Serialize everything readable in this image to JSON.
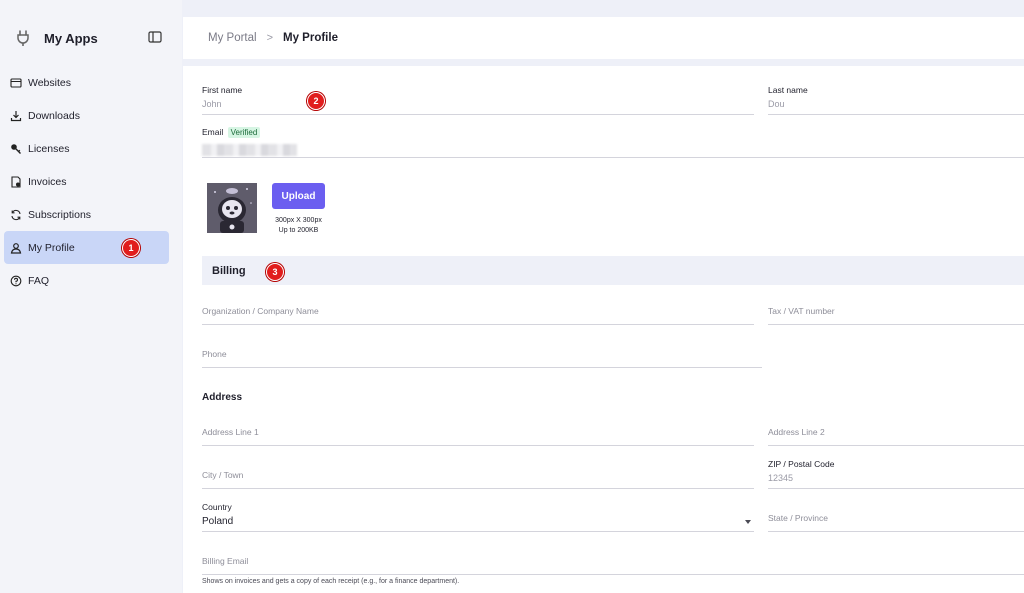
{
  "app": {
    "title": "My Apps",
    "logo_icon": "plug-icon",
    "collapse_icon": "sidebar-toggle-icon"
  },
  "sidebar": {
    "items": [
      {
        "label": "Websites",
        "icon": "browser-window-icon"
      },
      {
        "label": "Downloads",
        "icon": "download-icon"
      },
      {
        "label": "Licenses",
        "icon": "key-icon"
      },
      {
        "label": "Invoices",
        "icon": "invoice-icon"
      },
      {
        "label": "Subscriptions",
        "icon": "refresh-icon"
      },
      {
        "label": "My Profile",
        "icon": "user-icon",
        "active": true
      },
      {
        "label": "FAQ",
        "icon": "help-icon"
      }
    ]
  },
  "breadcrumb": {
    "parent": "My Portal",
    "separator": ">",
    "current": "My Profile"
  },
  "profile": {
    "first_name_label": "First name",
    "first_name_value": "John",
    "last_name_label": "Last name",
    "last_name_value": "Dou",
    "email_label": "Email",
    "email_badge": "Verified",
    "upload_label": "Upload",
    "upload_hint_line1": "300px X 300px",
    "upload_hint_line2": "Up to 200KB"
  },
  "billing": {
    "title": "Billing",
    "company_placeholder": "Organization / Company Name",
    "vat_placeholder": "Tax / VAT number",
    "phone_placeholder": "Phone"
  },
  "address": {
    "title": "Address",
    "line1_placeholder": "Address Line 1",
    "line2_placeholder": "Address Line 2",
    "city_placeholder": "City / Town",
    "zip_label": "ZIP / Postal Code",
    "zip_placeholder": "12345",
    "country_label": "Country",
    "country_value": "Poland",
    "state_placeholder": "State / Province",
    "billing_email_placeholder": "Billing Email",
    "billing_email_help": "Shows on invoices and gets a copy of each receipt (e.g., for a finance department)."
  },
  "markers": [
    "1",
    "2",
    "3"
  ],
  "colors": {
    "accent": "#6b5ef0",
    "active_nav": "#c9d6f7",
    "verified_bg": "#d6f5e3",
    "marker": "#e11d1d"
  }
}
